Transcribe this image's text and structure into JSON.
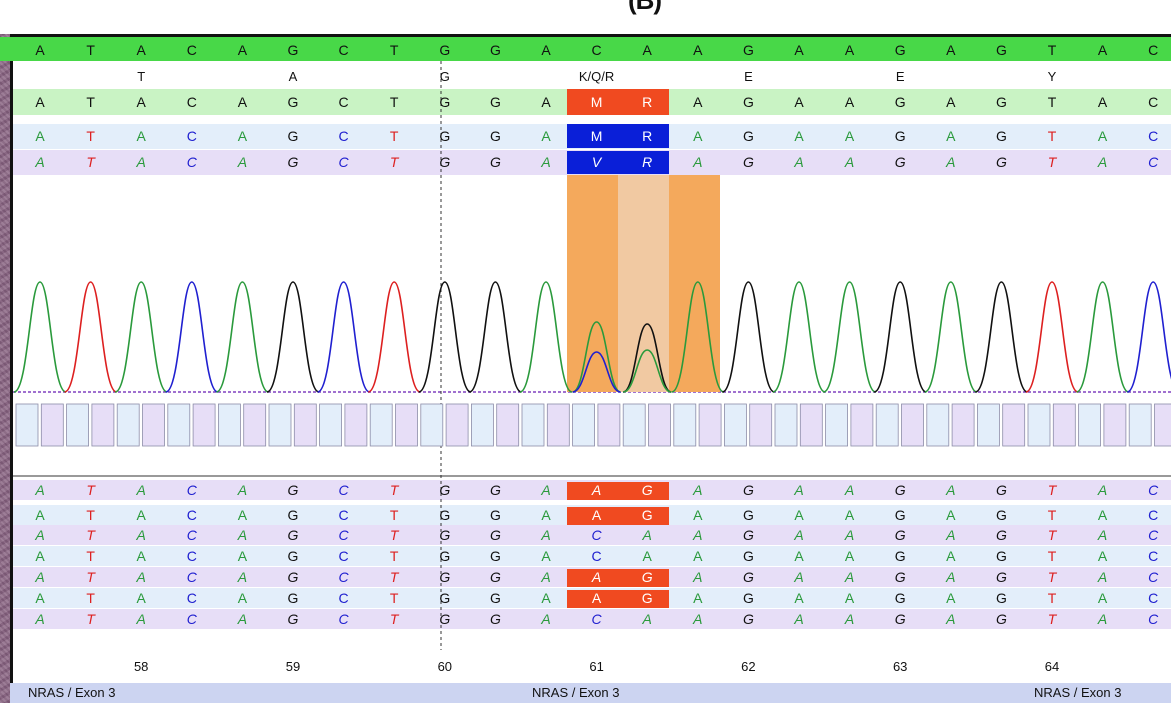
{
  "panel_label": "(B)",
  "amino_acids": [
    "T",
    "A",
    "G",
    "Q",
    "E",
    "E",
    "Y"
  ],
  "amino_acids_sample": [
    "T",
    "A",
    "G",
    "K/Q/R",
    "E",
    "E",
    "Y"
  ],
  "reference_sequence": [
    "A",
    "T",
    "A",
    "C",
    "A",
    "G",
    "C",
    "T",
    "G",
    "G",
    "A",
    "C",
    "A",
    "A",
    "G",
    "A",
    "A",
    "G",
    "A",
    "G",
    "T",
    "A",
    "C"
  ],
  "consensus_sequence": [
    "A",
    "T",
    "A",
    "C",
    "A",
    "G",
    "C",
    "T",
    "G",
    "G",
    "A",
    "M",
    "R",
    "A",
    "G",
    "A",
    "A",
    "G",
    "A",
    "G",
    "T",
    "A",
    "C"
  ],
  "sequence_track_1": [
    "A",
    "T",
    "A",
    "C",
    "A",
    "G",
    "C",
    "T",
    "G",
    "G",
    "A",
    "M",
    "R",
    "A",
    "G",
    "A",
    "A",
    "G",
    "A",
    "G",
    "T",
    "A",
    "C"
  ],
  "sequence_track_2": [
    "A",
    "T",
    "A",
    "C",
    "A",
    "G",
    "C",
    "T",
    "G",
    "G",
    "A",
    "V",
    "R",
    "A",
    "G",
    "A",
    "A",
    "G",
    "A",
    "G",
    "T",
    "A",
    "C"
  ],
  "sample_reads": [
    [
      "A",
      "T",
      "A",
      "C",
      "A",
      "G",
      "C",
      "T",
      "G",
      "G",
      "A",
      "A",
      "G",
      "A",
      "G",
      "A",
      "A",
      "G",
      "A",
      "G",
      "T",
      "A",
      "C"
    ],
    [
      "A",
      "T",
      "A",
      "C",
      "A",
      "G",
      "C",
      "T",
      "G",
      "G",
      "A",
      "A",
      "G",
      "A",
      "G",
      "A",
      "A",
      "G",
      "A",
      "G",
      "T",
      "A",
      "C"
    ],
    [
      "A",
      "T",
      "A",
      "C",
      "A",
      "G",
      "C",
      "T",
      "G",
      "G",
      "A",
      "C",
      "A",
      "A",
      "G",
      "A",
      "A",
      "G",
      "A",
      "G",
      "T",
      "A",
      "C"
    ],
    [
      "A",
      "T",
      "A",
      "C",
      "A",
      "G",
      "C",
      "T",
      "G",
      "G",
      "A",
      "C",
      "A",
      "A",
      "G",
      "A",
      "A",
      "G",
      "A",
      "G",
      "T",
      "A",
      "C"
    ],
    [
      "A",
      "T",
      "A",
      "C",
      "A",
      "G",
      "C",
      "T",
      "G",
      "G",
      "A",
      "A",
      "G",
      "A",
      "G",
      "A",
      "A",
      "G",
      "A",
      "G",
      "T",
      "A",
      "C"
    ],
    [
      "A",
      "T",
      "A",
      "C",
      "A",
      "G",
      "C",
      "T",
      "G",
      "G",
      "A",
      "A",
      "G",
      "A",
      "G",
      "A",
      "A",
      "G",
      "A",
      "G",
      "T",
      "A",
      "C"
    ],
    [
      "A",
      "T",
      "A",
      "C",
      "A",
      "G",
      "C",
      "T",
      "G",
      "G",
      "A",
      "C",
      "A",
      "A",
      "G",
      "A",
      "A",
      "G",
      "A",
      "G",
      "T",
      "A",
      "C"
    ]
  ],
  "codon_numbers": [
    "58",
    "59",
    "60",
    "61",
    "62",
    "63",
    "64"
  ],
  "region_labels": [
    "NRAS / Exon 3",
    "NRAS / Exon 3",
    "NRAS / Exon 3"
  ],
  "colors": {
    "base_A": "#2a9a3c",
    "base_C": "#2020d0",
    "base_G": "#111111",
    "base_T": "#dd2020",
    "reference_band": "#48d848",
    "consensus_band": "#c9f3c4",
    "track_blue": "#e3eefa",
    "track_purple": "#e7def7",
    "mutation_red": "#f04a20",
    "mutation_blue": "#0a1fd8",
    "highlight_orange": "#f4a95c",
    "highlight_light": "#f1c9a2",
    "footer_blue": "#ccd4f1"
  }
}
